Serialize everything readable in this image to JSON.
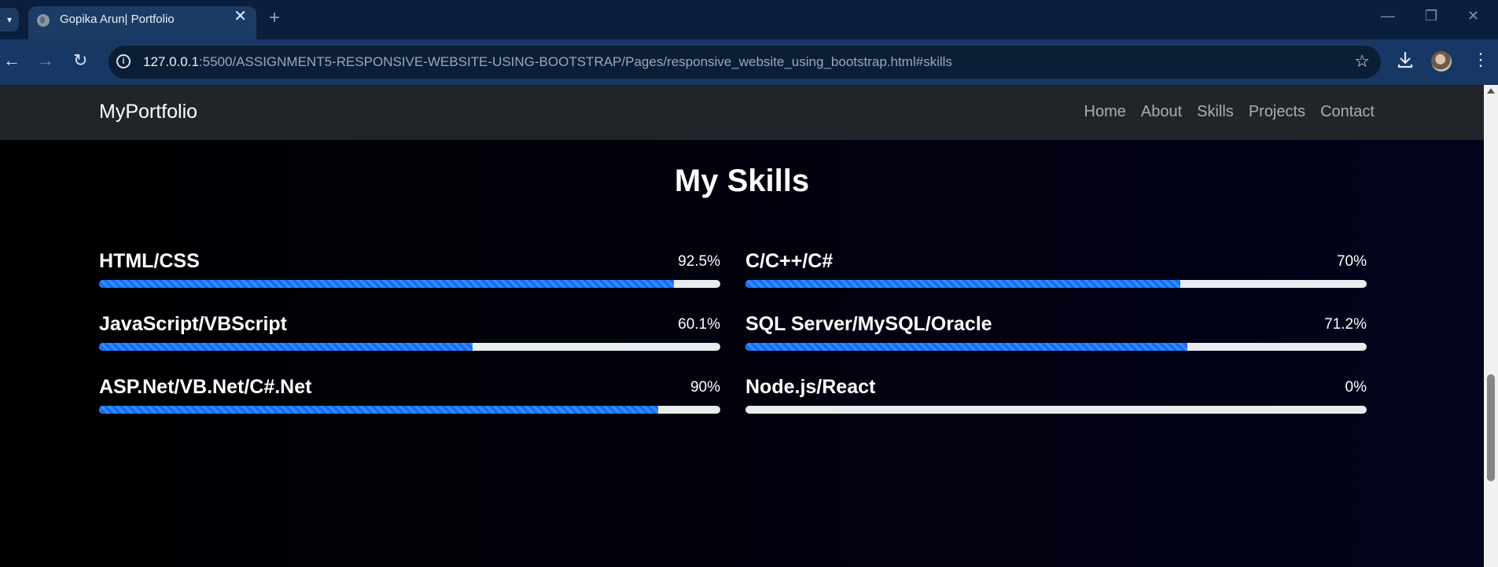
{
  "browser": {
    "tab_title": "Gopika Arun| Portfolio",
    "tab_close": "✕",
    "new_tab": "+",
    "url_host": "127.0.0.1",
    "url_rest": ":5500/ASSIGNMENT5-RESPONSIVE-WEBSITE-USING-BOOTSTRAP/Pages/responsive_website_using_bootstrap.html#skills",
    "info_glyph": "i",
    "icons": [
      "tab-search-icon",
      "globe-icon",
      "close-icon",
      "plus-icon",
      "minimize-icon",
      "restore-icon",
      "window-close-icon",
      "back-arrow-icon",
      "forward-arrow-icon",
      "reload-icon",
      "info-icon",
      "star-icon",
      "download-icon",
      "avatar",
      "menu-dots-icon"
    ]
  },
  "navbar": {
    "brand": "MyPortfolio",
    "links": [
      "Home",
      "About",
      "Skills",
      "Projects",
      "Contact"
    ]
  },
  "skills": {
    "title": "My Skills",
    "bar_color": "#0d6efd",
    "items": [
      {
        "name": "HTML/CSS",
        "percent_label": "92.5%",
        "value": 92.5
      },
      {
        "name": "C/C++/C#",
        "percent_label": "70%",
        "value": 70
      },
      {
        "name": "JavaScript/VBScript",
        "percent_label": "60.1%",
        "value": 60.1
      },
      {
        "name": "SQL Server/MySQL/Oracle",
        "percent_label": "71.2%",
        "value": 71.2
      },
      {
        "name": "ASP.Net/VB.Net/C#.Net",
        "percent_label": "90%",
        "value": 90
      },
      {
        "name": "Node.js/React",
        "percent_label": "0%",
        "value": 0
      }
    ]
  }
}
